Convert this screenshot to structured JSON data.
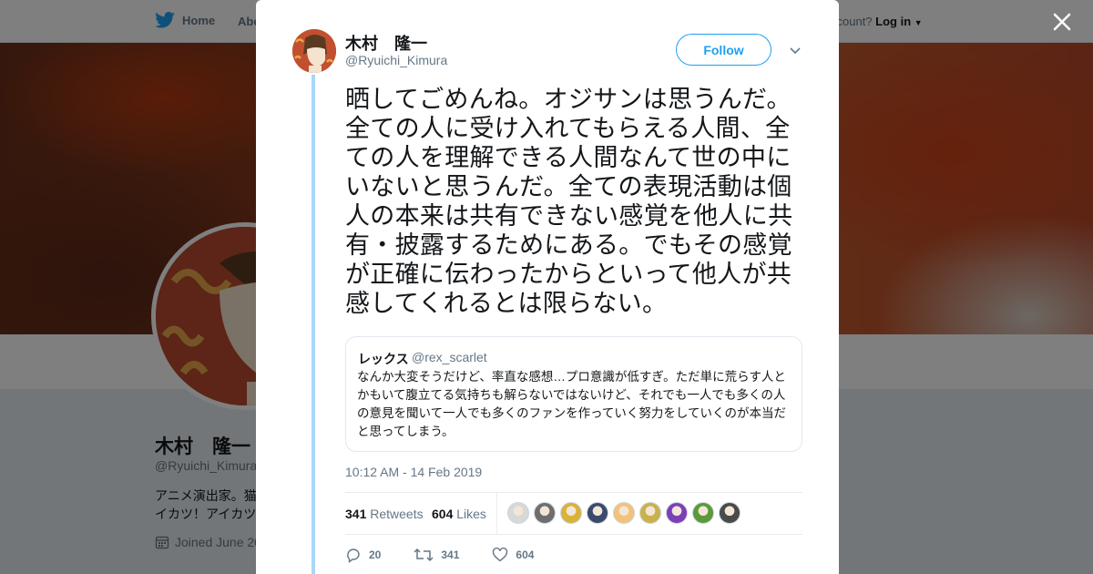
{
  "background": {
    "nav": {
      "home_label": "Home",
      "about_label": "Abo",
      "account_prompt": "ccount?",
      "login_label": "Log in"
    },
    "profile": {
      "name": "木村　隆一",
      "handle": "@Ryuichi_Kimura",
      "bio_line1": "アニメ演出家。猫",
      "bio_line2": "イカツ！アイカツ",
      "joined": "Joined June 20"
    }
  },
  "tweet": {
    "author_name": "木村　隆一",
    "author_handle": "@Ryuichi_Kimura",
    "follow_label": "Follow",
    "text": "晒してごめんね。オジサンは思うんだ。全ての人に受け入れてもらえる人間、全ての人を理解できる人間なんて世の中にいないと思うんだ。全ての表現活動は個人の本来は共有できない感覚を他人に共有・披露するためにある。でもその感覚が正確に伝わったからといって他人が共感してくれるとは限らない。",
    "quoted": {
      "name": "レックス",
      "handle": "@rex_scarlet",
      "text": "なんか大変そうだけど、率直な感想…プロ意識が低すぎ。ただ単に荒らす人とかもいて腹立てる気持ちも解らないではないけど、それでも一人でも多くの人の意見を聞いて一人でも多くのファンを作っていく努力をしていくのが本当だと思ってしまう。"
    },
    "timestamp": "10:12 AM - 14 Feb 2019",
    "retweets": {
      "count": "341",
      "label": "Retweets"
    },
    "likes": {
      "count": "604",
      "label": "Likes"
    },
    "liker_colors": [
      "#d8d8d8",
      "#6e6e6e",
      "#d9b23a",
      "#3b4a6b",
      "#f2c27a",
      "#c9b24a",
      "#7b3fb8",
      "#5b9a3a",
      "#4a4a4a"
    ],
    "actions": {
      "reply_count": "20",
      "retweet_count": "341",
      "like_count": "604"
    }
  },
  "colors": {
    "accent": "#1da1f2",
    "thread_line": "#a7d8f7"
  }
}
